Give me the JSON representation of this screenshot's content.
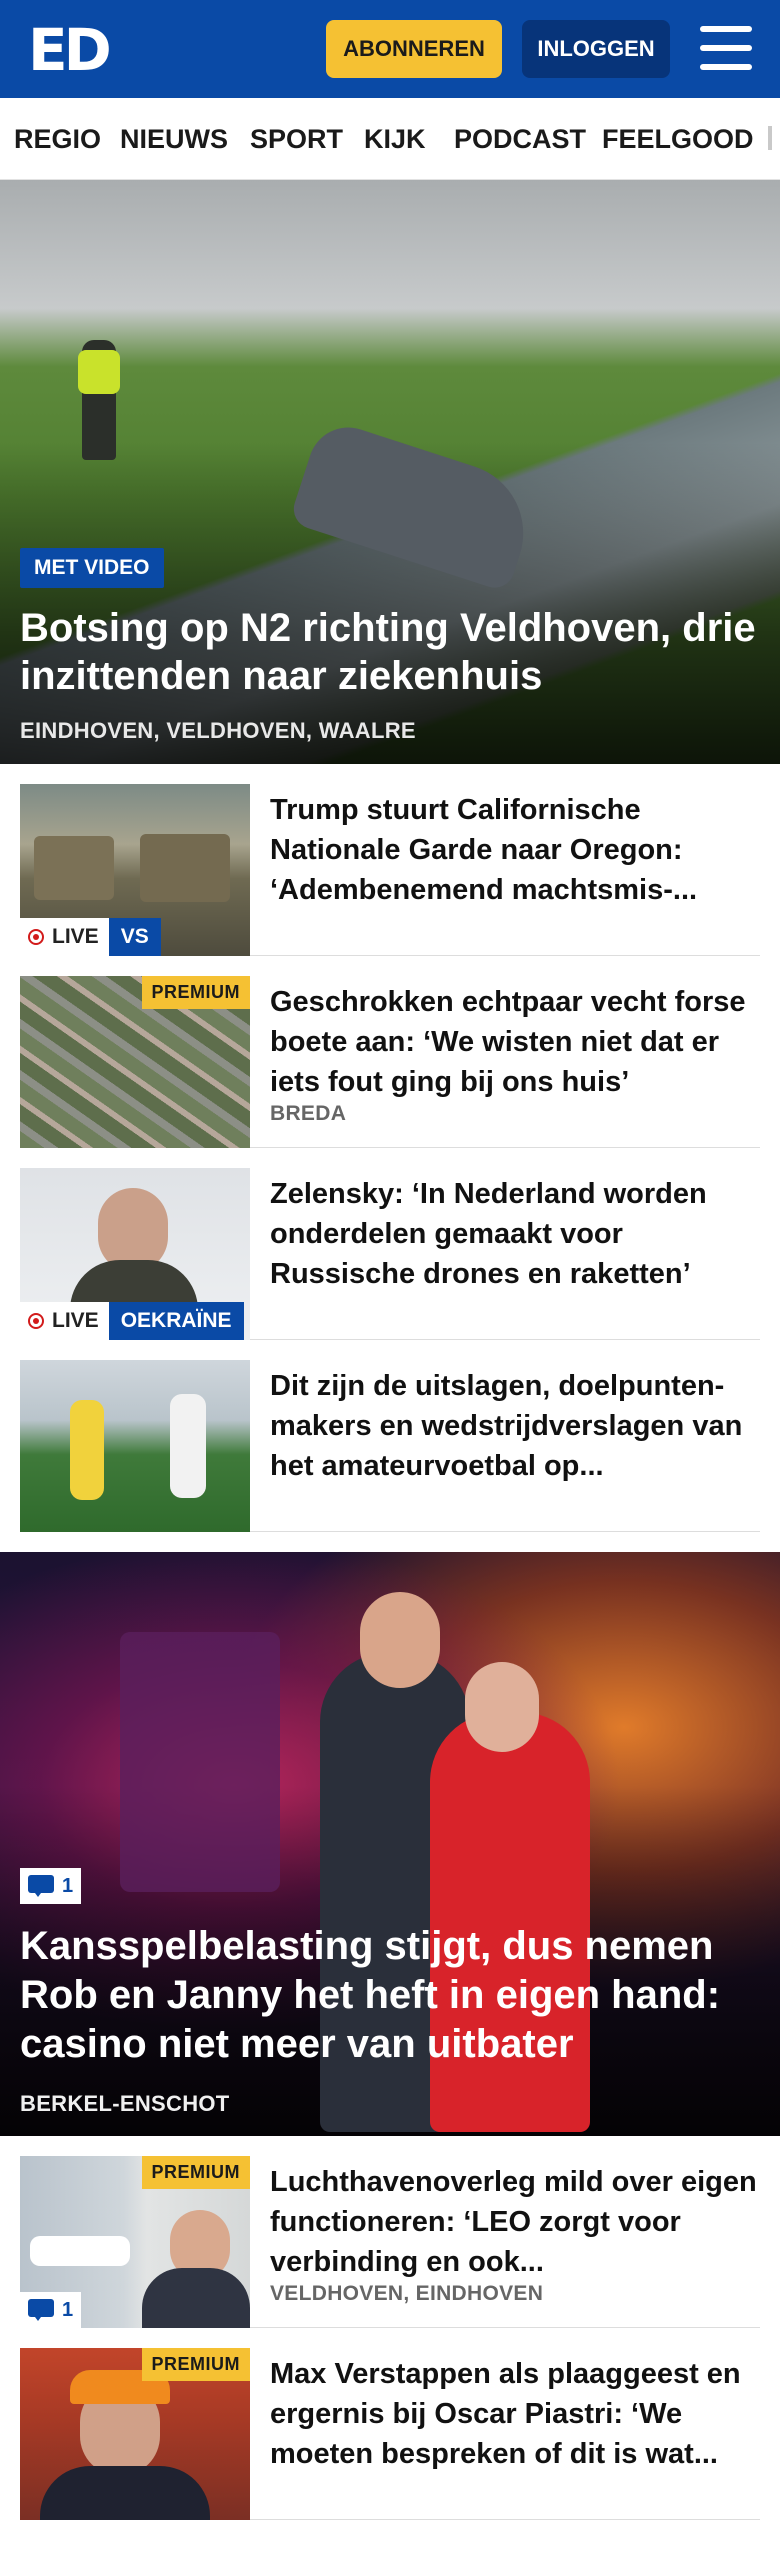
{
  "header": {
    "logo": "ED",
    "subscribe_label": "ABONNEREN",
    "login_label": "INLOGGEN"
  },
  "nav": {
    "items": [
      "REGIO",
      "NIEUWS",
      "SPORT",
      "KIJK",
      "PODCAST",
      "FEELGOOD"
    ]
  },
  "hero": {
    "badge": "MET VIDEO",
    "title": "Botsing op N2 richting Veldhoven, drie inzittenden naar ziekenhuis",
    "location": "EINDHOVEN, VELDHOVEN, WAALRE"
  },
  "articles": [
    {
      "title": "Trump stuurt Californische Nationale Garde naar Oregon: ‘Adembenemend machtsmis-...",
      "live": "LIVE",
      "tag": "VS"
    },
    {
      "title": "Geschrokken echtpaar vecht forse boete aan: ‘We wisten niet dat er iets fout ging bij ons huis’",
      "premium": "PREMIUM",
      "location": "BREDA"
    },
    {
      "title": "Zelensky: ‘In Nederland worden onderdelen gemaakt voor Russische drones en raketten’",
      "live": "LIVE",
      "tag": "OEKRAÏNE"
    },
    {
      "title": "Dit zijn de uitslagen, doelpunten-makers en wedstrijdverslagen van het amateurvoetbal op..."
    }
  ],
  "feature": {
    "comments": "1",
    "title": "Kansspelbelasting stijgt, dus nemen Rob en Janny het heft in eigen hand: casino niet meer van uitbater",
    "location": "BERKEL-ENSCHOT"
  },
  "articles2": [
    {
      "title": "Luchthavenoverleg mild over eigen functioneren: ‘LEO zorgt voor verbinding en ook...",
      "premium": "PREMIUM",
      "comments": "1",
      "location": "VELDHOVEN, EINDHOVEN"
    },
    {
      "title": "Max Verstappen als plaaggeest en ergernis bij Oscar Piastri: ‘We moeten bespreken of dit is wat...",
      "premium": "PREMIUM"
    }
  ],
  "colors": {
    "brand_blue": "#0a4aa6",
    "subscribe_yellow": "#f5c133",
    "login_dark_blue": "#07347a",
    "live_red": "#d21b1b"
  },
  "icons": [
    "menu-icon",
    "live-dot-icon",
    "comment-icon"
  ]
}
